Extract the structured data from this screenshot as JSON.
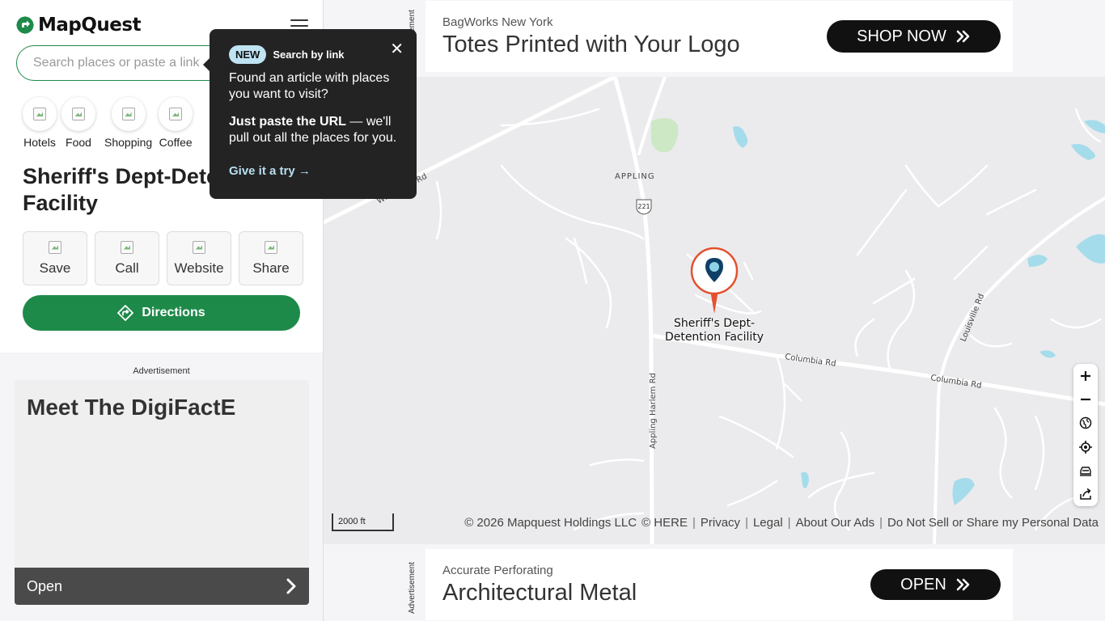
{
  "app": {
    "logo_text": "MapQuest",
    "search_placeholder": "Search places or paste a link"
  },
  "categories": [
    {
      "label": "Hotels",
      "icon": "hotel-icon"
    },
    {
      "label": "Food",
      "icon": "food-icon"
    },
    {
      "label": "Shopping",
      "icon": "shopping-icon"
    },
    {
      "label": "Coffee",
      "icon": "coffee-icon"
    }
  ],
  "place": {
    "title": "Sheriff's Dept-Detention Facility",
    "actions": [
      {
        "label": "Save"
      },
      {
        "label": "Call"
      },
      {
        "label": "Website"
      },
      {
        "label": "Share"
      }
    ],
    "directions_label": "Directions"
  },
  "popover": {
    "badge": "NEW",
    "title": "Search by link",
    "body1": "Found an article with places you want to visit?",
    "body2_bold": "Just paste the URL",
    "body2_rest": " — we'll pull out all the places for you.",
    "cta": "Give it a try →"
  },
  "left_ad": {
    "label": "Advertisement",
    "headline": "Meet The DigiFactE",
    "bar_label": "Open"
  },
  "top_ad": {
    "label": "Advertisement",
    "brand": "BagWorks New York",
    "headline": "Totes Printed with Your Logo",
    "button": "SHOP NOW"
  },
  "bottom_ad": {
    "label": "Advertisement",
    "brand": "Accurate Perforating",
    "headline": "Architectural Metal",
    "button": "OPEN"
  },
  "map": {
    "pin_label_line1": "Sheriff's Dept-",
    "pin_label_line2": "Detention Facility",
    "place_label": "APPLING",
    "route_shield": "221",
    "roads": {
      "appling_harlem": "Appling Harlem Rd",
      "columbia1": "Columbia Rd",
      "columbia2": "Columbia Rd",
      "louisville": "Louisville Rd",
      "white_oak": "White Oak Rd"
    },
    "scale": "2000 ft",
    "copyright": "© 2026 Mapquest Holdings LLC",
    "links": [
      "© HERE",
      "Privacy",
      "Legal",
      "About Our Ads",
      "Do Not Sell or Share my Personal Data"
    ],
    "colors": {
      "water": "#a5dceb",
      "park": "#cde8c4",
      "pin": "#e4502f",
      "pin_icon": "#0f3f66"
    }
  },
  "controls": [
    "zoom-in-icon",
    "zoom-out-icon",
    "globe-icon",
    "locate-icon",
    "traffic-icon",
    "share-map-icon"
  ],
  "colors": {
    "brand_green": "#1e8a4a",
    "dark": "#232323",
    "badge": "#bfe3f2"
  }
}
